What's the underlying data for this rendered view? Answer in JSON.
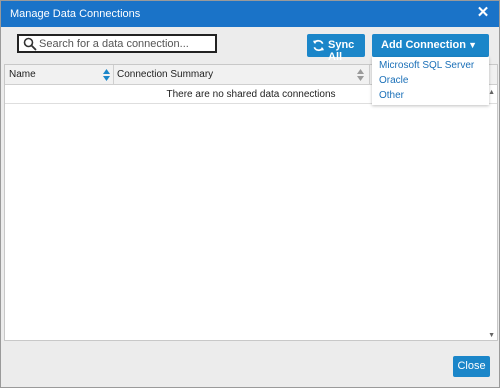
{
  "window": {
    "title": "Manage Data Connections"
  },
  "search": {
    "placeholder": "Search for a data connection..."
  },
  "toolbar": {
    "sync_label": "Sync All",
    "add_label": "Add Connection"
  },
  "add_menu": {
    "items": [
      "Microsoft SQL Server",
      "Oracle",
      "Other"
    ]
  },
  "grid": {
    "columns": [
      "Name",
      "Connection Summary"
    ],
    "empty_message": "There are no shared data connections"
  },
  "footer": {
    "close_label": "Close"
  },
  "colors": {
    "titlebar": "#1a73c8",
    "button": "#1b86c9",
    "link": "#1b70b8",
    "background": "#ececec"
  }
}
